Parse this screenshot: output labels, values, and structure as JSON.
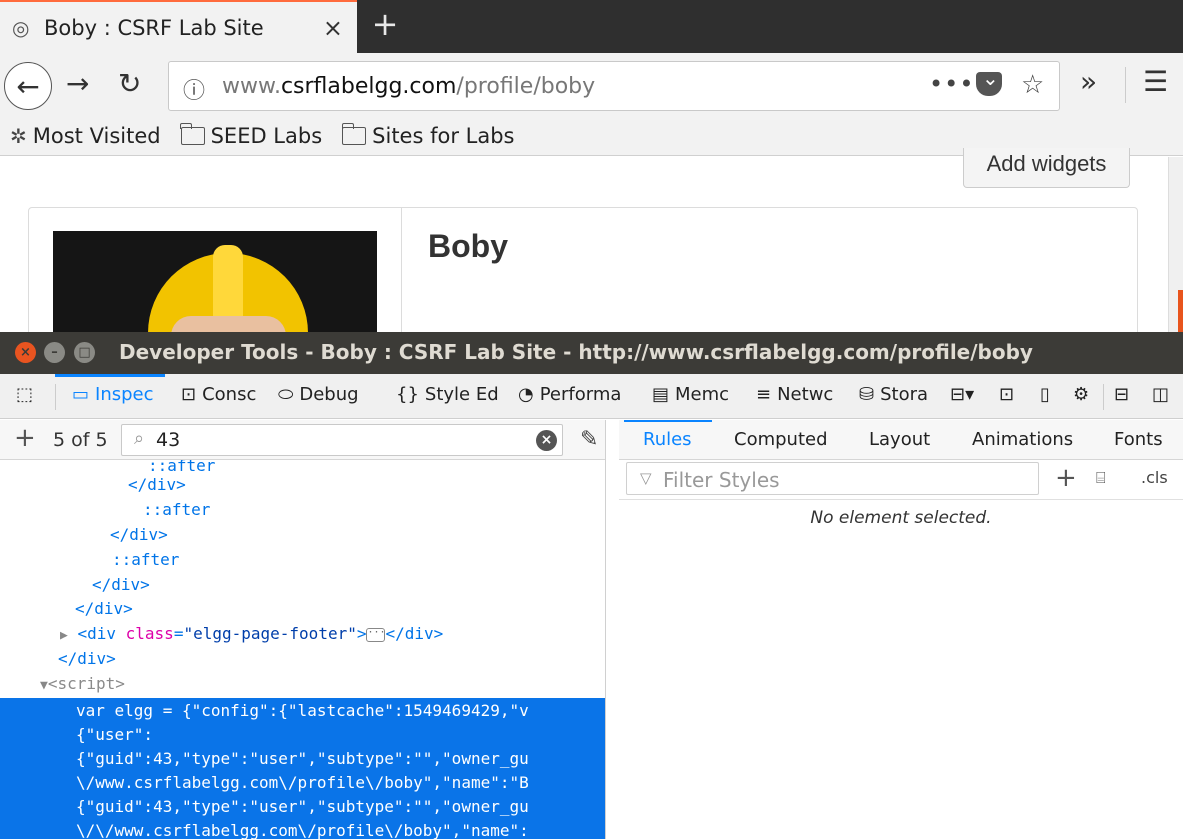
{
  "browser": {
    "tab_title": "Boby : CSRF Lab Site",
    "tab_close": "×",
    "new_tab": "+",
    "url_domain": "www.csrflabelgg.com",
    "url_prefix": "www.",
    "url_host": "csrflabelgg.com",
    "url_path": "/profile/boby",
    "page_actions": "•••",
    "overflow": "»",
    "menu": "☰"
  },
  "bookmarks": [
    {
      "label": "Most Visited",
      "icon": "gear-icon"
    },
    {
      "label": "SEED Labs",
      "icon": "folder-icon"
    },
    {
      "label": "Sites for Labs",
      "icon": "folder-icon"
    }
  ],
  "page": {
    "add_widgets": "Add widgets",
    "profile_name": "Boby"
  },
  "devtools": {
    "window_title": "Developer Tools - Boby : CSRF Lab Site - http://www.csrflabelgg.com/profile/boby",
    "tools": [
      "Inspec",
      "Consc",
      "Debug",
      "Style Ed",
      "Performa",
      "Memc",
      "Netwc",
      "Stora"
    ],
    "match_count": "5 of 5",
    "search_value": "43",
    "markup": {
      "l0": "::after",
      "l1": "</div>",
      "l2": "::after",
      "l3": "</div>",
      "l4": "::after",
      "l5": "</div>",
      "l6": "</div>",
      "footer_open": "<div",
      "footer_attr": "class",
      "footer_val": "\"elgg-page-footer\"",
      "footer_close": "</div>",
      "l8": "</div>",
      "script_tag": "<script>"
    },
    "selected_lines": [
      "var elgg = {\"config\":{\"lastcache\":1549469429,\"v",
      "{\"user\":",
      "{\"guid\":43,\"type\":\"user\",\"subtype\":\"\",\"owner_gu",
      "\\/www.csrflabelgg.com\\/profile\\/boby\",\"name\":\"B",
      "{\"guid\":43,\"type\":\"user\",\"subtype\":\"\",\"owner_gu",
      "\\/\\/www.csrflabelgg.com\\/profile\\/boby\",\"name\":"
    ],
    "rules_tabs": [
      "Rules",
      "Computed",
      "Layout",
      "Animations",
      "Fonts"
    ],
    "filter_placeholder": "Filter Styles",
    "cls_label": ".cls",
    "no_element": "No element selected."
  },
  "colors": {
    "accent": "#0a84ff",
    "selection": "#0a74e8",
    "ubuntu_orange": "#e95420"
  }
}
